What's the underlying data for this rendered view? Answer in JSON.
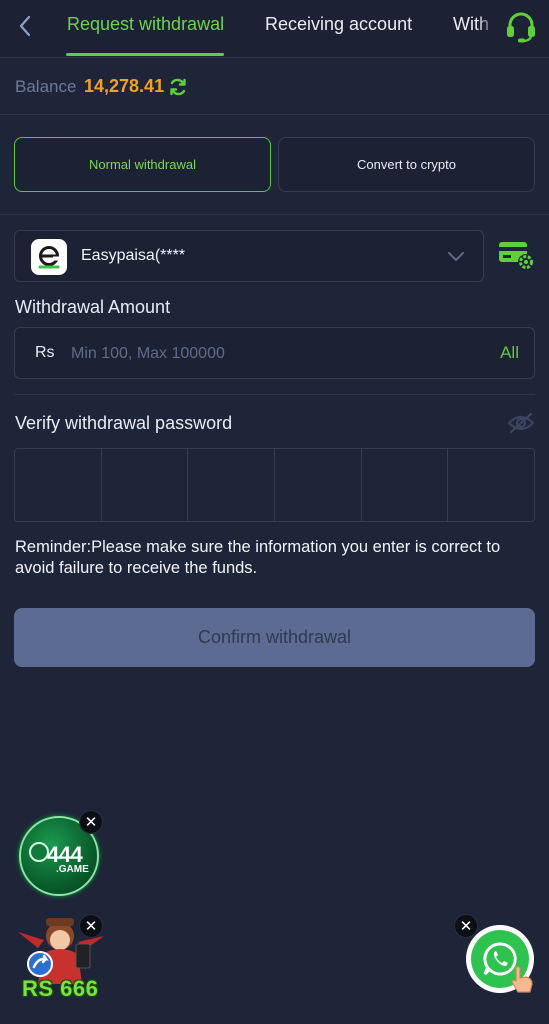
{
  "header": {
    "tabs": [
      {
        "label": "Request withdrawal",
        "active": true
      },
      {
        "label": "Receiving account",
        "active": false
      },
      {
        "label": "With",
        "active": false
      }
    ],
    "accent_color": "#5fd03a"
  },
  "balance": {
    "label": "Balance",
    "value": "14,278.41",
    "value_color": "#f0a31f"
  },
  "modes": {
    "normal": "Normal withdrawal",
    "crypto": "Convert to crypto",
    "selected": "normal"
  },
  "account": {
    "name": "Easypaisa(****",
    "logo_letter": "e"
  },
  "amount": {
    "label": "Withdrawal Amount",
    "currency": "Rs",
    "placeholder": "Min 100, Max 100000",
    "value": "",
    "all_label": "All"
  },
  "password": {
    "label": "Verify withdrawal password",
    "cells": 6
  },
  "reminder": "Reminder:Please make sure the information you enter is correct to avoid failure to receive the funds.",
  "confirm_label": "Confirm withdrawal",
  "floating": {
    "game_badge": {
      "number": "444",
      "sub": ".GAME"
    },
    "promo_text": "RS 666",
    "close_symbol": "✕"
  },
  "icons": [
    "back-arrow-icon",
    "headset-icon",
    "refresh-icon",
    "chevron-down-icon",
    "card-settings-icon",
    "eye-off-icon",
    "close-icon",
    "whatsapp-icon"
  ]
}
